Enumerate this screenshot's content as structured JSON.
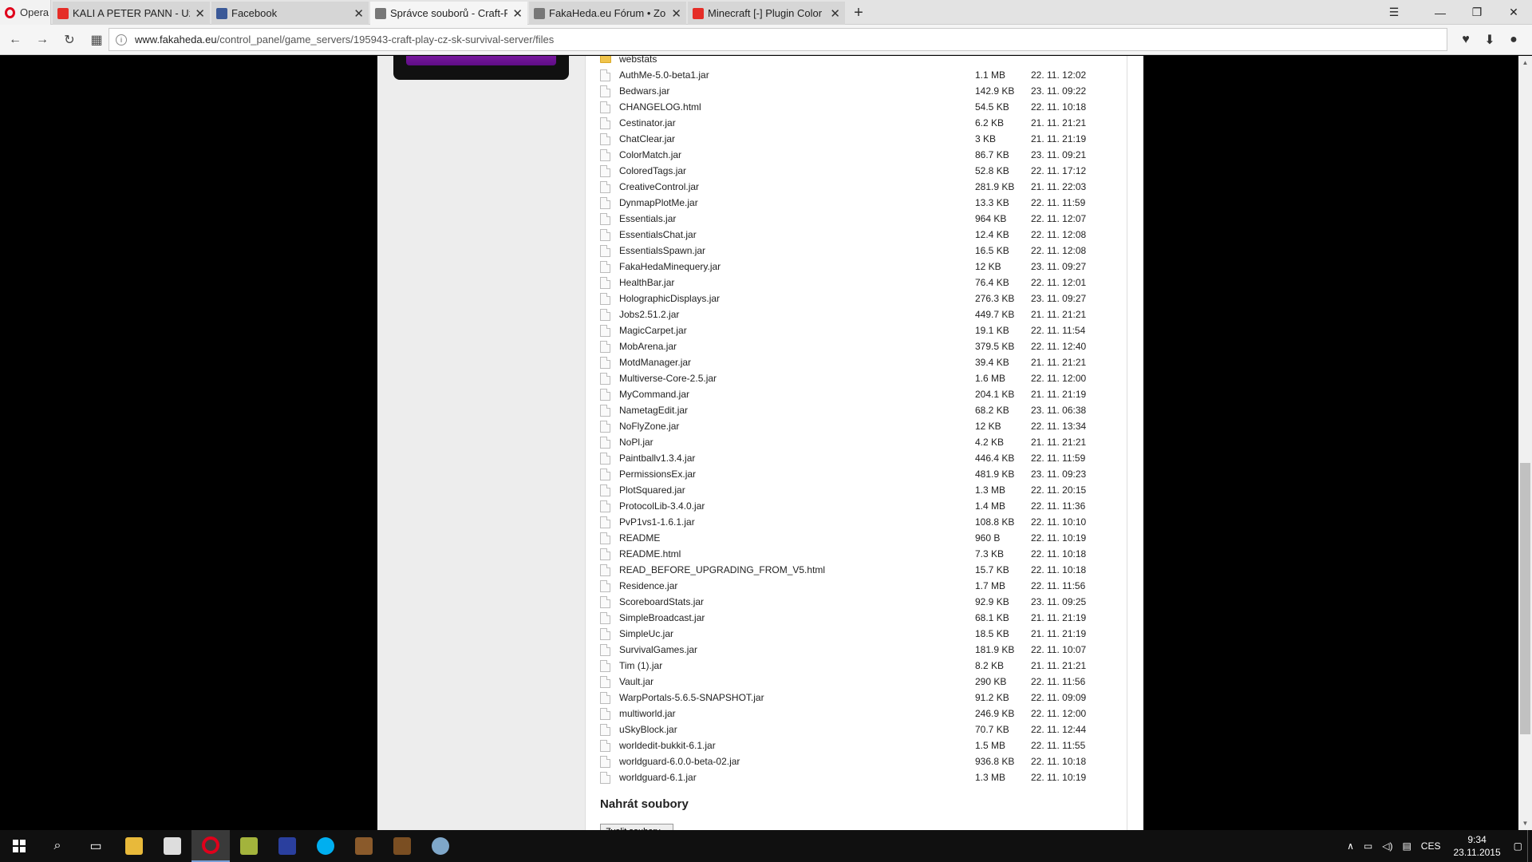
{
  "browser": {
    "brand": "Opera",
    "tabs": [
      {
        "title": "KALI A PETER PANN - Uživ",
        "favicon_color": "#e52d27"
      },
      {
        "title": "Facebook",
        "favicon_color": "#3b5998"
      },
      {
        "title": "Správce souborů - Craft-Pl",
        "favicon_color": "#777777",
        "active": true
      },
      {
        "title": "FakaHeda.eu Fórum • Zob",
        "favicon_color": "#777777"
      },
      {
        "title": "Minecraft [-] Plugin Color",
        "favicon_color": "#e52d27"
      }
    ],
    "url_host": "www.fakaheda.eu",
    "url_path": "/control_panel/game_servers/195943-craft-play-cz-sk-survival-server/files"
  },
  "files": [
    {
      "name": "webstats",
      "size": "",
      "date": "",
      "type": "folder"
    },
    {
      "name": "AuthMe-5.0-beta1.jar",
      "size": "1.1 MB",
      "date": "22. 11. 12:02"
    },
    {
      "name": "Bedwars.jar",
      "size": "142.9 KB",
      "date": "23. 11. 09:22"
    },
    {
      "name": "CHANGELOG.html",
      "size": "54.5 KB",
      "date": "22. 11. 10:18"
    },
    {
      "name": "Cestinator.jar",
      "size": "6.2 KB",
      "date": "21. 11. 21:21"
    },
    {
      "name": "ChatClear.jar",
      "size": "3 KB",
      "date": "21. 11. 21:19"
    },
    {
      "name": "ColorMatch.jar",
      "size": "86.7 KB",
      "date": "23. 11. 09:21"
    },
    {
      "name": "ColoredTags.jar",
      "size": "52.8 KB",
      "date": "22. 11. 17:12"
    },
    {
      "name": "CreativeControl.jar",
      "size": "281.9 KB",
      "date": "21. 11. 22:03"
    },
    {
      "name": "DynmapPlotMe.jar",
      "size": "13.3 KB",
      "date": "22. 11. 11:59"
    },
    {
      "name": "Essentials.jar",
      "size": "964 KB",
      "date": "22. 11. 12:07"
    },
    {
      "name": "EssentialsChat.jar",
      "size": "12.4 KB",
      "date": "22. 11. 12:08"
    },
    {
      "name": "EssentialsSpawn.jar",
      "size": "16.5 KB",
      "date": "22. 11. 12:08"
    },
    {
      "name": "FakaHedaMinequery.jar",
      "size": "12 KB",
      "date": "23. 11. 09:27"
    },
    {
      "name": "HealthBar.jar",
      "size": "76.4 KB",
      "date": "22. 11. 12:01"
    },
    {
      "name": "HolographicDisplays.jar",
      "size": "276.3 KB",
      "date": "23. 11. 09:27"
    },
    {
      "name": "Jobs2.51.2.jar",
      "size": "449.7 KB",
      "date": "21. 11. 21:21"
    },
    {
      "name": "MagicCarpet.jar",
      "size": "19.1 KB",
      "date": "22. 11. 11:54"
    },
    {
      "name": "MobArena.jar",
      "size": "379.5 KB",
      "date": "22. 11. 12:40"
    },
    {
      "name": "MotdManager.jar",
      "size": "39.4 KB",
      "date": "21. 11. 21:21"
    },
    {
      "name": "Multiverse-Core-2.5.jar",
      "size": "1.6 MB",
      "date": "22. 11. 12:00"
    },
    {
      "name": "MyCommand.jar",
      "size": "204.1 KB",
      "date": "21. 11. 21:19"
    },
    {
      "name": "NametagEdit.jar",
      "size": "68.2 KB",
      "date": "23. 11. 06:38"
    },
    {
      "name": "NoFlyZone.jar",
      "size": "12 KB",
      "date": "22. 11. 13:34"
    },
    {
      "name": "NoPl.jar",
      "size": "4.2 KB",
      "date": "21. 11. 21:21"
    },
    {
      "name": "Paintballv1.3.4.jar",
      "size": "446.4 KB",
      "date": "22. 11. 11:59"
    },
    {
      "name": "PermissionsEx.jar",
      "size": "481.9 KB",
      "date": "23. 11. 09:23"
    },
    {
      "name": "PlotSquared.jar",
      "size": "1.3 MB",
      "date": "22. 11. 20:15"
    },
    {
      "name": "ProtocolLib-3.4.0.jar",
      "size": "1.4 MB",
      "date": "22. 11. 11:36"
    },
    {
      "name": "PvP1vs1-1.6.1.jar",
      "size": "108.8 KB",
      "date": "22. 11. 10:10"
    },
    {
      "name": "README",
      "size": "960 B",
      "date": "22. 11. 10:19"
    },
    {
      "name": "README.html",
      "size": "7.3 KB",
      "date": "22. 11. 10:18"
    },
    {
      "name": "READ_BEFORE_UPGRADING_FROM_V5.html",
      "size": "15.7 KB",
      "date": "22. 11. 10:18"
    },
    {
      "name": "Residence.jar",
      "size": "1.7 MB",
      "date": "22. 11. 11:56"
    },
    {
      "name": "ScoreboardStats.jar",
      "size": "92.9 KB",
      "date": "23. 11. 09:25"
    },
    {
      "name": "SimpleBroadcast.jar",
      "size": "68.1 KB",
      "date": "21. 11. 21:19"
    },
    {
      "name": "SimpleUc.jar",
      "size": "18.5 KB",
      "date": "21. 11. 21:19"
    },
    {
      "name": "SurvivalGames.jar",
      "size": "181.9 KB",
      "date": "22. 11. 10:07"
    },
    {
      "name": "Tim (1).jar",
      "size": "8.2 KB",
      "date": "21. 11. 21:21"
    },
    {
      "name": "Vault.jar",
      "size": "290 KB",
      "date": "22. 11. 11:56"
    },
    {
      "name": "WarpPortals-5.6.5-SNAPSHOT.jar",
      "size": "91.2 KB",
      "date": "22. 11. 09:09"
    },
    {
      "name": "multiworld.jar",
      "size": "246.9 KB",
      "date": "22. 11. 12:00"
    },
    {
      "name": "uSkyBlock.jar",
      "size": "70.7 KB",
      "date": "22. 11. 12:44"
    },
    {
      "name": "worldedit-bukkit-6.1.jar",
      "size": "1.5 MB",
      "date": "22. 11. 11:55"
    },
    {
      "name": "worldguard-6.0.0-beta-02.jar",
      "size": "936.8 KB",
      "date": "22. 11. 10:18"
    },
    {
      "name": "worldguard-6.1.jar",
      "size": "1.3 MB",
      "date": "22. 11. 10:19"
    }
  ],
  "upload": {
    "title": "Nahrát soubory",
    "button": "Zvolit soubory"
  },
  "taskbar": {
    "lang": "CES",
    "time": "9:34",
    "date": "23.11.2015"
  }
}
